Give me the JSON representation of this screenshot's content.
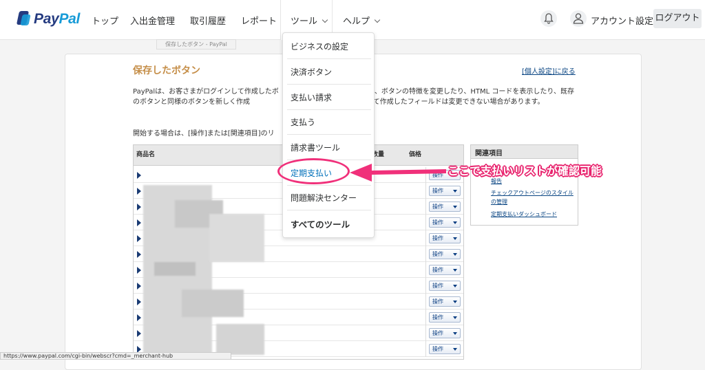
{
  "brand": {
    "logo_pay": "Pay",
    "logo_pal": "Pal"
  },
  "nav": {
    "items": [
      "トップ",
      "入出金管理",
      "取引履歴",
      "レポート"
    ],
    "tools": "ツール",
    "help": "ヘルプ",
    "account": "アカウント設定",
    "logout": "ログアウト"
  },
  "tab_title": "保存したボタン - PayPal",
  "page": {
    "title": "保存したボタン",
    "back_link": "[個人設定]に戻る",
    "intro": "PayPalは、お客さまがログインして作成したボ　　　　　　　　す。ここでは、ボタンの特徴を変更したり、HTML コードを表示したり、既存のボタンと同様のボタンを新しく作成　　　　　　　　ただし、API を使用して作成したフィールドは変更できない場合があります。",
    "start": "開始する場合は、[操作]または[関連項目]のリ"
  },
  "table": {
    "headers": {
      "name": "商品名",
      "qty": "数量",
      "price": "価格"
    },
    "action_label": "操作",
    "row_count": 12
  },
  "related": {
    "title": "関連項目",
    "links": [
      "報告",
      "チェックアウトページのスタイルの管理",
      "定期支払いダッシュボード"
    ]
  },
  "dropdown": {
    "items": [
      "ビジネスの設定",
      "決済ボタン",
      "支払い請求",
      "支払う",
      "請求書ツール",
      "定期支払い",
      "問題解決センター",
      "すべてのツール"
    ]
  },
  "annotation": "ここで支払いリストが確認可能",
  "status_url": "https://www.paypal.com/cgi-bin/webscr?cmd=_merchant-hub",
  "colors": {
    "accent": "#0070ba",
    "annotation": "#f0307a",
    "title": "#c58e48"
  }
}
